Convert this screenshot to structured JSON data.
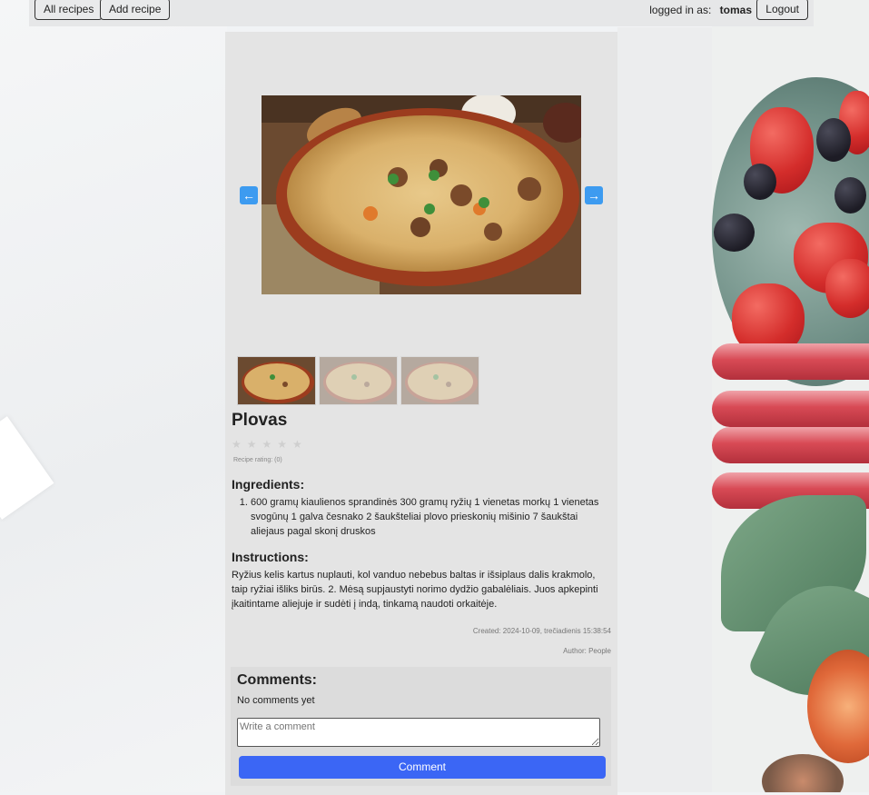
{
  "nav": {
    "all_recipes": "All recipes",
    "add_recipe": "Add recipe",
    "logged_in_label": "logged in as:",
    "username": "tomas",
    "logout": "Logout"
  },
  "carousel": {
    "prev_icon": "arrow-left-icon",
    "next_icon": "arrow-right-icon",
    "thumbnail_count": 3,
    "active_index": 0
  },
  "recipe": {
    "title": "Plovas",
    "stars": "★★★★★",
    "rating_text": "Recipe rating: (0)",
    "ingredients_heading": "Ingredients:",
    "ingredients": [
      "600 gramų kiaulienos sprandinės 300 gramų ryžių 1 vienetas morkų 1 vienetas svogūnų 1 galva česnako 2 šaukšteliai plovo prieskonių mišinio 7 šaukštai aliejaus pagal skonį druskos"
    ],
    "instructions_heading": "Instructions:",
    "instructions": "Ryžius kelis kartus nuplauti, kol vanduo nebebus baltas ir išsiplaus dalis krakmolo, taip ryžiai išliks birūs. 2. Mėsą supjaustyti norimo dydžio gabalėliais. Juos apkepinti įkaitintame aliejuje ir sudėti į indą, tinkamą naudoti orkaitėje.",
    "created": "Created: 2024-10-09, trečiadienis 15:38:54",
    "author": "Author: People"
  },
  "comments": {
    "heading": "Comments:",
    "empty_text": "No comments yet",
    "input_placeholder": "Write a comment",
    "submit_label": "Comment"
  },
  "colors": {
    "accent_button": "#3b66f5",
    "carousel_arrow": "#3d9bf0"
  }
}
